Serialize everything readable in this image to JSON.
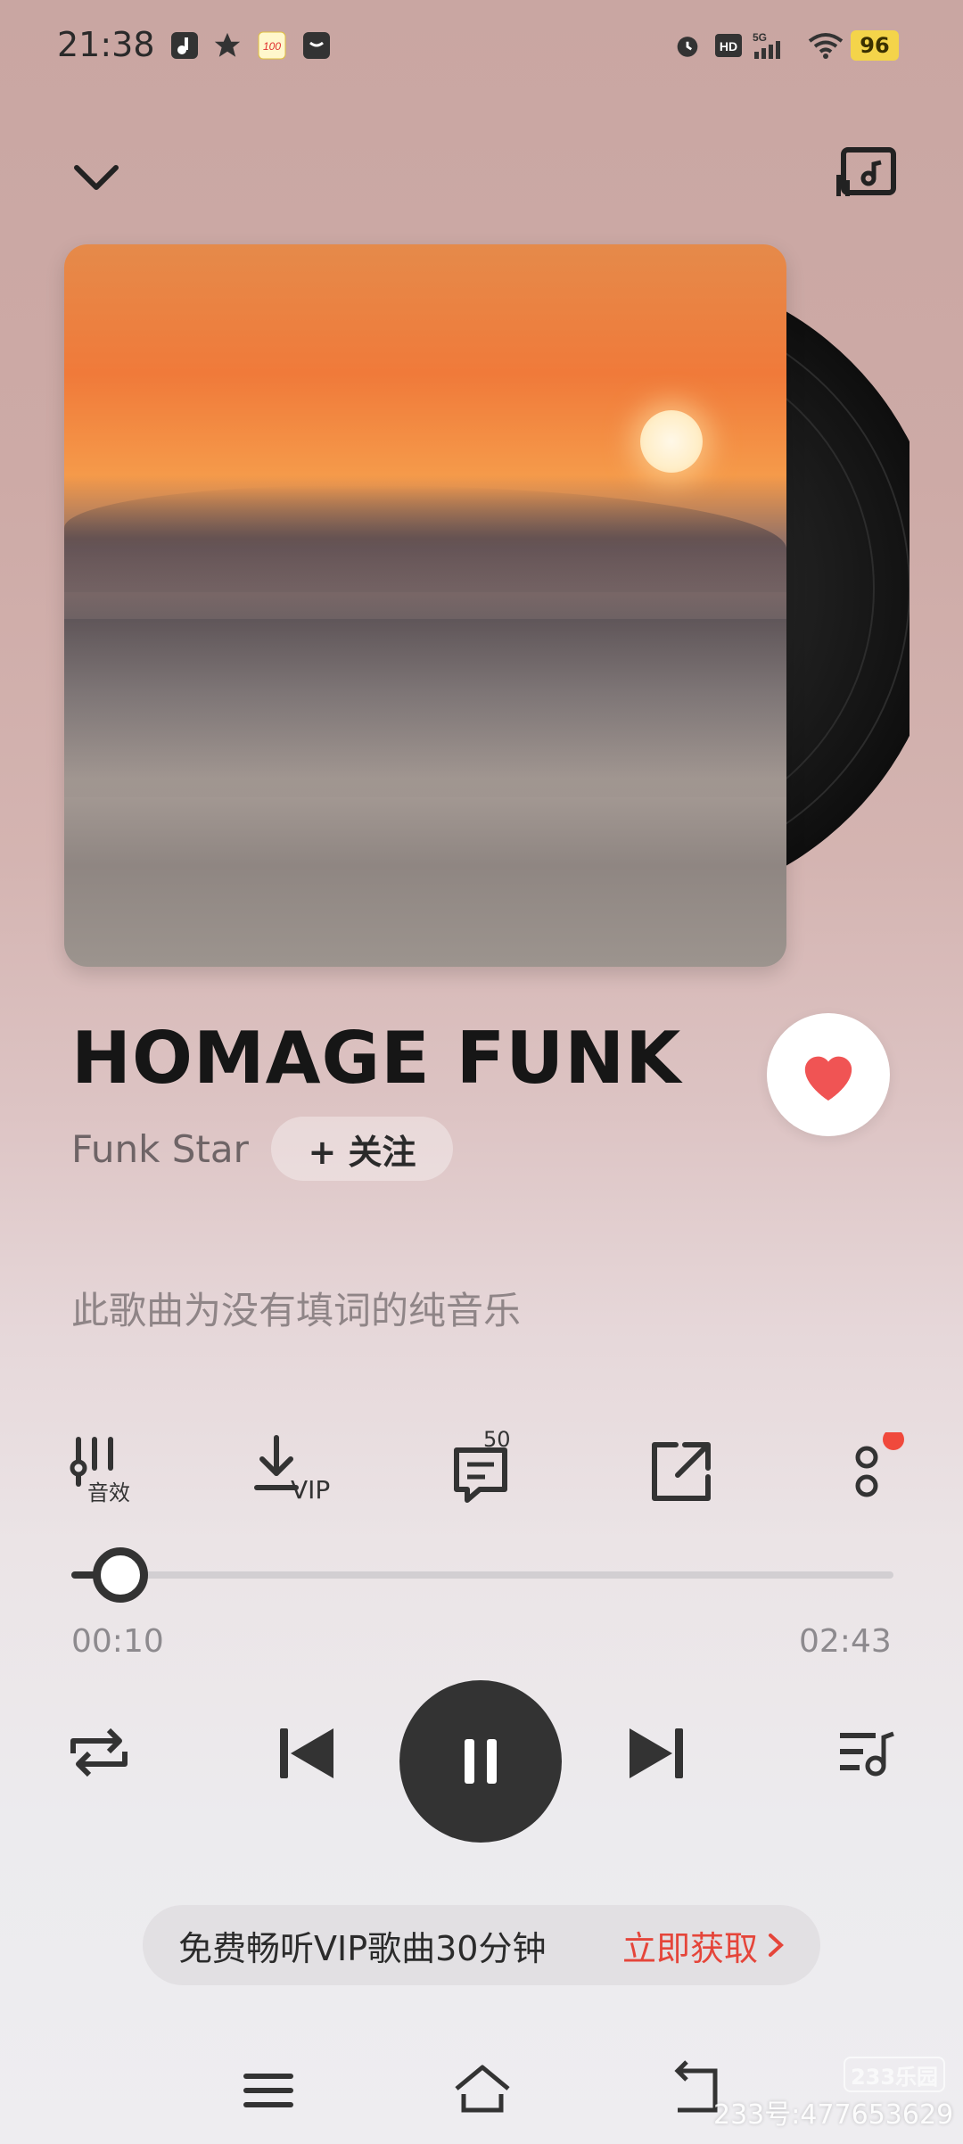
{
  "status_bar": {
    "time": "21:38",
    "battery": "96",
    "network": "5G"
  },
  "song": {
    "title": "HOMAGE FUNK",
    "artist": "Funk Star",
    "follow_label": "+ 关注",
    "lyrics_note": "此歌曲为没有填词的纯音乐"
  },
  "tools": {
    "sound_effect_label": "音效",
    "download_label": "VIP",
    "comments_count": "50"
  },
  "player": {
    "current_time": "00:10",
    "total_time": "02:43",
    "progress_fraction": 0.06
  },
  "vip_banner": {
    "text": "免费畅听VIP歌曲30分钟",
    "cta": "立即获取"
  },
  "watermark": {
    "text": "233号:477653629",
    "logo": "233乐园"
  },
  "colors": {
    "accent_red": "#e5453a",
    "heart": "#f05454"
  }
}
